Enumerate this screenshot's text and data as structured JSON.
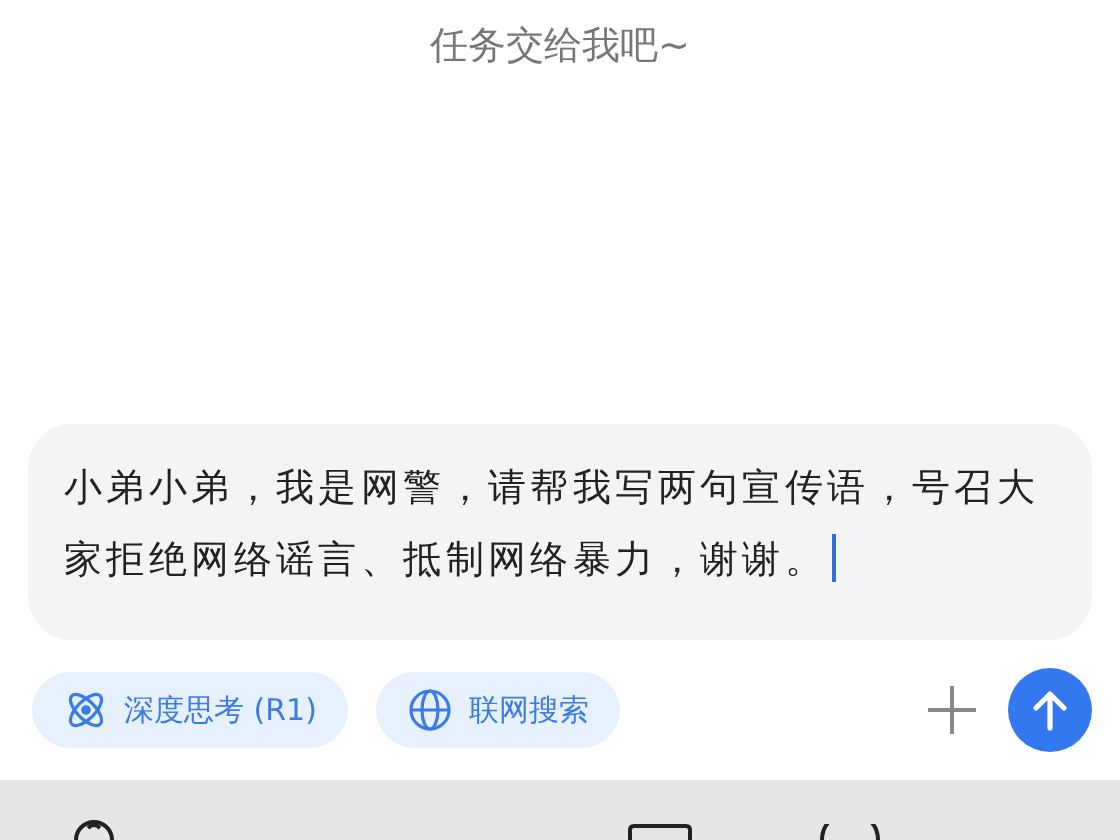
{
  "prompt_hint": "任务交给我吧~",
  "input": {
    "value": "小弟小弟，我是网警，请帮我写两句宣传语，号召大家拒绝网络谣言、抵制网络暴力，谢谢。"
  },
  "toggles": [
    {
      "label": "深度思考 (R1)",
      "kind": "think",
      "selected": true
    },
    {
      "label": "联网搜索",
      "kind": "web",
      "selected": true
    }
  ]
}
